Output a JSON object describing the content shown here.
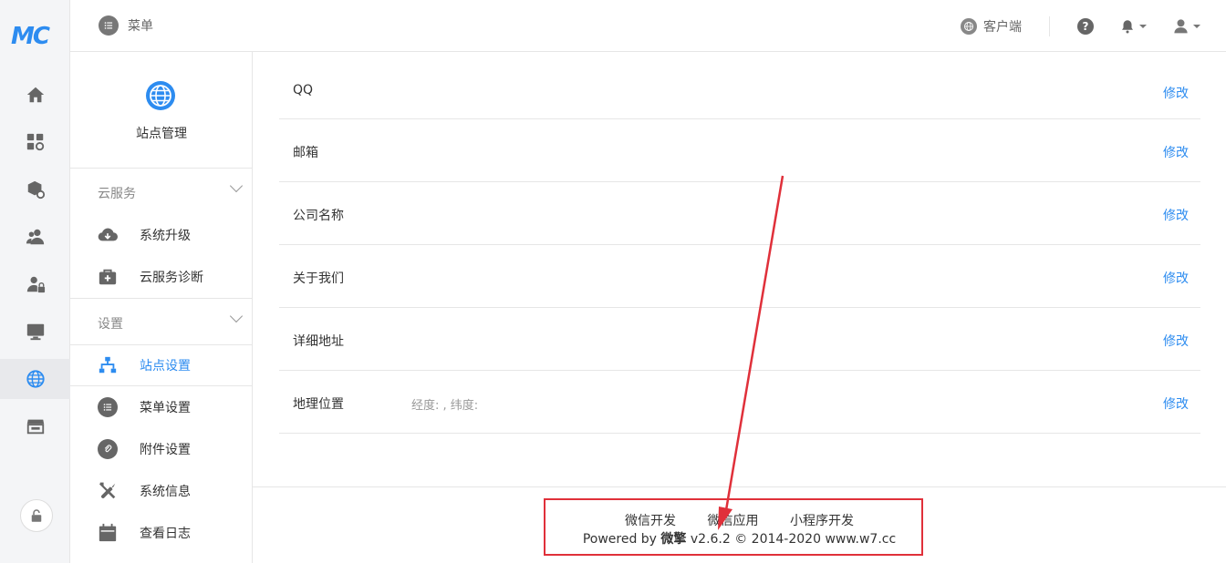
{
  "brand": {
    "logo_text": "MC"
  },
  "topbar": {
    "menu_label": "菜单",
    "client_label": "客户端"
  },
  "sidebar": {
    "site_title": "站点管理",
    "groups": [
      {
        "title": "云服务",
        "items": [
          {
            "label": "系统升级",
            "icon": "cloud-download-icon"
          },
          {
            "label": "云服务诊断",
            "icon": "medical-kit-icon"
          }
        ]
      },
      {
        "title": "设置",
        "items": [
          {
            "label": "站点设置",
            "icon": "sitemap-icon",
            "active": true
          },
          {
            "label": "菜单设置",
            "icon": "list-icon"
          },
          {
            "label": "附件设置",
            "icon": "paperclip-icon"
          },
          {
            "label": "系统信息",
            "icon": "tools-icon"
          },
          {
            "label": "查看日志",
            "icon": "calendar-icon"
          }
        ]
      }
    ]
  },
  "settings": {
    "edit_label": "修改",
    "rows": [
      {
        "key": "QQ",
        "value": ""
      },
      {
        "key": "邮箱",
        "value": ""
      },
      {
        "key": "公司名称",
        "value": ""
      },
      {
        "key": "关于我们",
        "value": ""
      },
      {
        "key": "详细地址",
        "value": ""
      },
      {
        "key": "地理位置",
        "value": "经度: , 纬度:"
      }
    ]
  },
  "footer": {
    "links": [
      "微信开发",
      "微信应用",
      "小程序开发"
    ],
    "powered_prefix": "Powered by",
    "brand": "微擎",
    "version_text": "v2.6.2 © 2014-2020 www.w7.cc"
  },
  "colors": {
    "accent": "#2d8cf0",
    "annotation": "#e0303a"
  }
}
